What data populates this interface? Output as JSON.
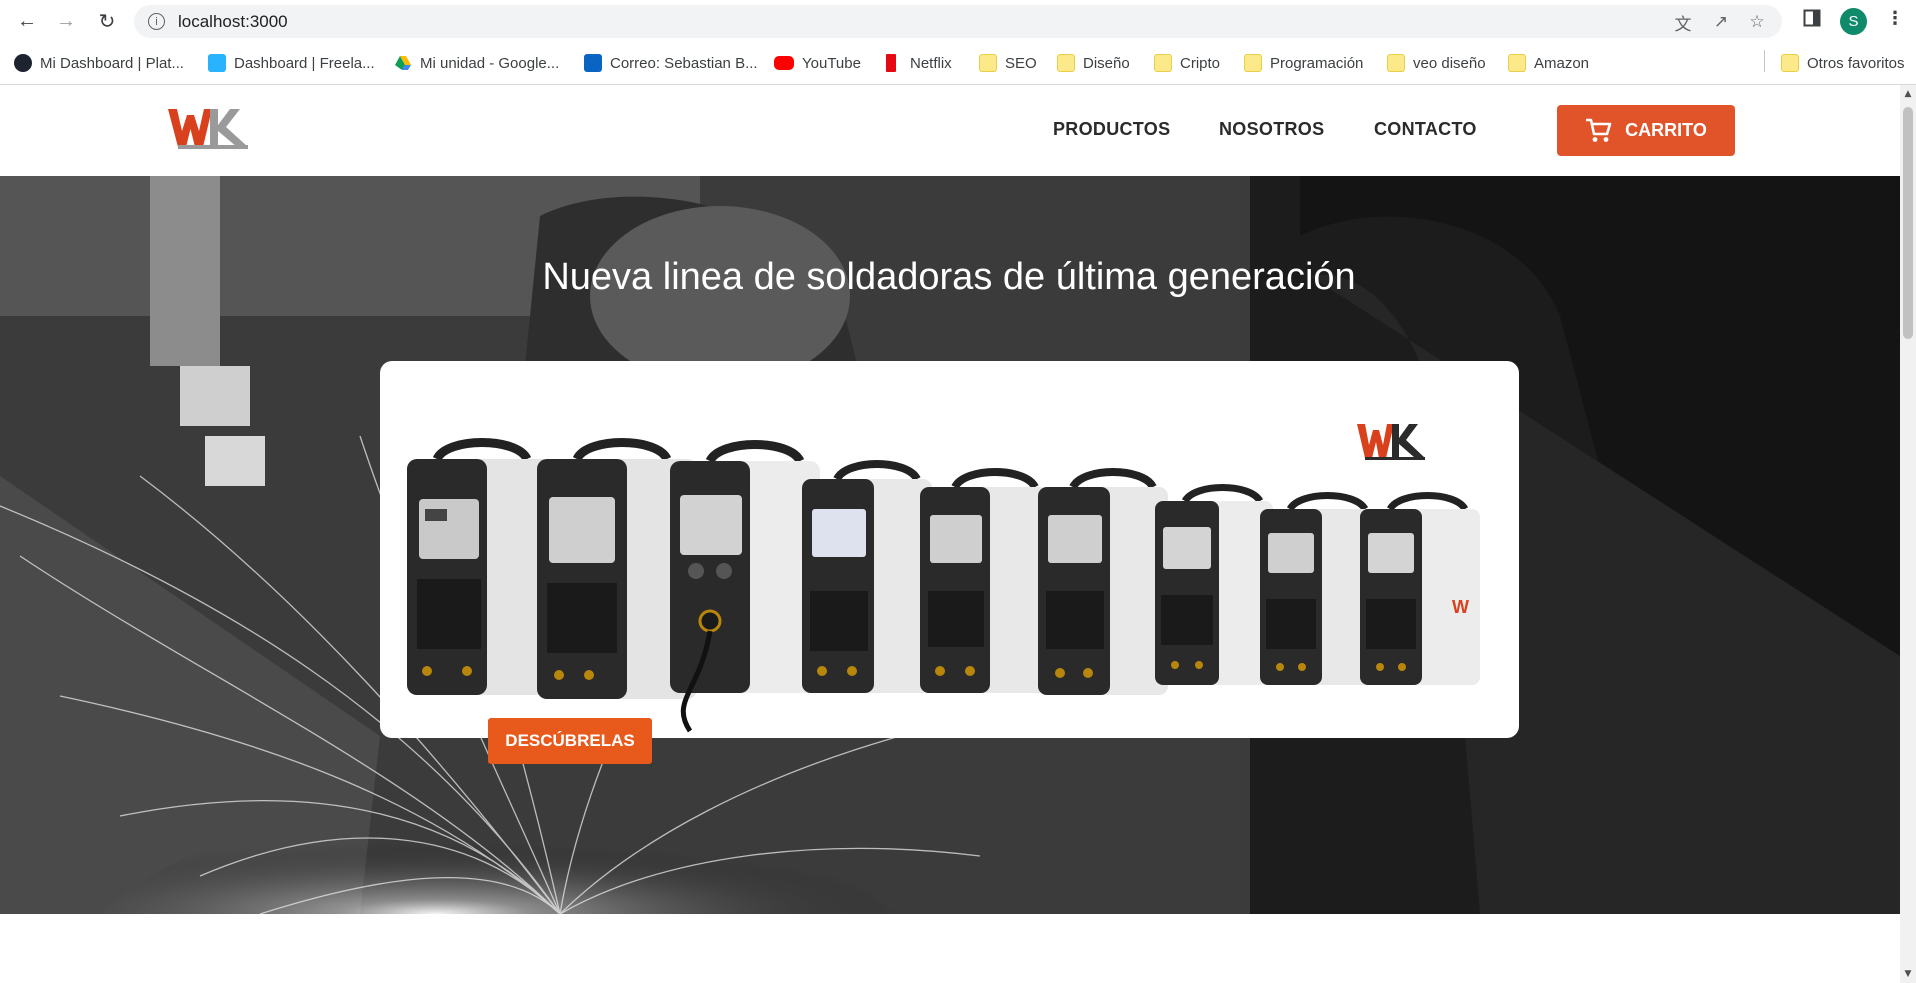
{
  "browser": {
    "url": "localhost:3000",
    "avatar_letter": "S",
    "bookmarks": [
      {
        "label": "Mi Dashboard | Plat...",
        "icon": "platzi-icon"
      },
      {
        "label": "Dashboard | Freela...",
        "icon": "freelancer-icon"
      },
      {
        "label": "Mi unidad - Google...",
        "icon": "google-drive-icon"
      },
      {
        "label": "Correo: Sebastian B...",
        "icon": "outlook-icon"
      },
      {
        "label": "YouTube",
        "icon": "youtube-icon"
      },
      {
        "label": "Netflix",
        "icon": "netflix-icon"
      },
      {
        "label": "SEO",
        "icon": "folder-icon"
      },
      {
        "label": "Diseño",
        "icon": "folder-icon"
      },
      {
        "label": "Cripto",
        "icon": "folder-icon"
      },
      {
        "label": "Programación",
        "icon": "folder-icon"
      },
      {
        "label": "veo diseño",
        "icon": "folder-icon"
      },
      {
        "label": "Amazon",
        "icon": "folder-icon"
      }
    ],
    "other_bookmarks": "Otros favoritos"
  },
  "site": {
    "nav": {
      "products": "PRODUCTOS",
      "about": "NOSOTROS",
      "contact": "CONTACTO",
      "cart": "CARRITO"
    },
    "hero": {
      "title": "Nueva linea de soldadoras de última generación",
      "cta": "DESCÚBRELAS"
    }
  },
  "colors": {
    "accent": "#e1542a",
    "cta": "#e8591c",
    "brand_red": "#d9411e"
  }
}
